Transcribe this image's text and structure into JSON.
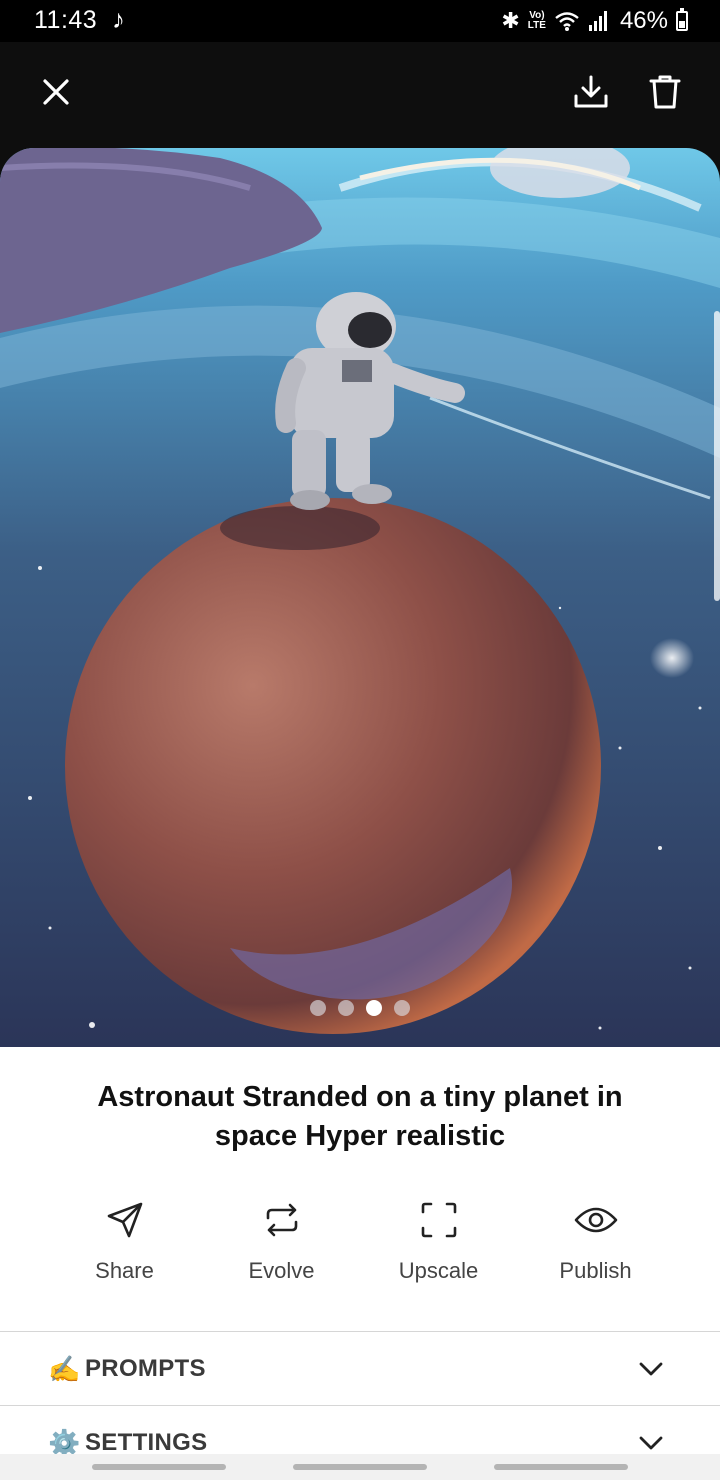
{
  "status_bar": {
    "time": "11:43",
    "music_icon": "music-note-icon",
    "network": "LTE",
    "volte": "Vo)",
    "battery_percent": "46%",
    "battery_level": 0.46
  },
  "app_bar": {
    "close_icon": "close-icon",
    "download_icon": "download-icon",
    "delete_icon": "trash-icon"
  },
  "image": {
    "description_icon": "generated-image",
    "carousel_count": 4,
    "carousel_active_index": 2
  },
  "title": "Astronaut Stranded on a tiny planet in space Hyper realistic",
  "actions": [
    {
      "label": "Share",
      "icon": "send-icon"
    },
    {
      "label": "Evolve",
      "icon": "repeat-icon"
    },
    {
      "label": "Upscale",
      "icon": "maximize-icon"
    },
    {
      "label": "Publish",
      "icon": "eye-icon"
    }
  ],
  "sections": [
    {
      "emoji": "✍️",
      "label": "PROMPTS",
      "icon": "chevron-down-icon"
    },
    {
      "emoji": "⚙️",
      "label": "SETTINGS",
      "icon": "chevron-down-icon"
    }
  ],
  "colors": {
    "header_bg": "#0e0e0e",
    "text": "#111111",
    "muted": "#444444"
  }
}
